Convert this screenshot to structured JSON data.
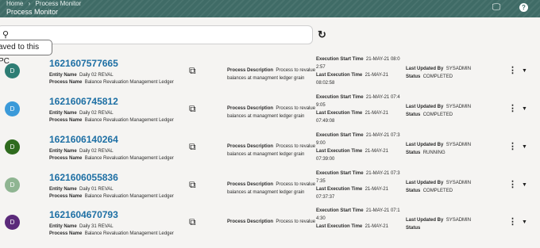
{
  "header": {
    "breadcrumb": [
      "Home",
      "›",
      "Process Monitor"
    ],
    "title": "Process Monitor"
  },
  "toolbar": {
    "tooltip": "aved to this PC"
  },
  "labels": {
    "entity_name": "Entity Name",
    "process_name": "Process Name",
    "process_description": "Process Description",
    "execution_start_time": "Execution Start Time",
    "last_execution_time": "Last Execution Time",
    "last_updated_by": "Last Updated By",
    "status": "Status"
  },
  "rows": [
    {
      "avatar": "D",
      "avatar_color": "#2e7d74",
      "id": "1621607577665",
      "entity": "Daily 02 REVAL",
      "process": "Balance Revaluation Management Ledger",
      "desc1": "Process to revalue",
      "desc2": "balances at managment ledger grain",
      "start": "21-MAY-21 08:0",
      "start2": "2:57",
      "last": "21-MAY-21",
      "last2": "08:02:58",
      "user": "SYSADMIN",
      "status": "COMPLETED"
    },
    {
      "avatar": "D",
      "avatar_color": "#3b9ad9",
      "id": "1621606745812",
      "entity": "Daily 02 REVAL",
      "process": "Balance Revaluation Management Ledger",
      "desc1": "Process to revalue",
      "desc2": "balances at managment ledger grain",
      "start": "21-MAY-21 07:4",
      "start2": "9:05",
      "last": "21-MAY-21",
      "last2": "07:49:08",
      "user": "SYSADMIN",
      "status": "COMPLETED"
    },
    {
      "avatar": "D",
      "avatar_color": "#2f6b1e",
      "id": "1621606140264",
      "entity": "Daily 02 REVAL",
      "process": "Balance Revaluation Management Ledger",
      "desc1": "Process to revalue",
      "desc2": "balances at managment ledger grain",
      "start": "21-MAY-21 07:3",
      "start2": "9:00",
      "last": "21-MAY-21",
      "last2": "07:39:00",
      "user": "SYSADMIN",
      "status": "RUNNING"
    },
    {
      "avatar": "D",
      "avatar_color": "#8fb592",
      "id": "1621606055836",
      "entity": "Daily 01 REVAL",
      "process": "Balance Revaluation Management Ledger",
      "desc1": "Process to revalue",
      "desc2": "balances at managment ledger grain",
      "start": "21-MAY-21 07:3",
      "start2": "7:35",
      "last": "21-MAY-21",
      "last2": "07:37:37",
      "user": "SYSADMIN",
      "status": "COMPLETED"
    },
    {
      "avatar": "D",
      "avatar_color": "#5b2a7a",
      "id": "1621604670793",
      "entity": "Daily 31 REVAL",
      "process": "Balance Revaluation Management Ledger",
      "desc1": "Process to revalue",
      "desc2": "",
      "start": "21-MAY-21 07:1",
      "start2": "4:30",
      "last": "21-MAY-21",
      "last2": "",
      "user": "SYSADMIN",
      "status": ""
    }
  ]
}
